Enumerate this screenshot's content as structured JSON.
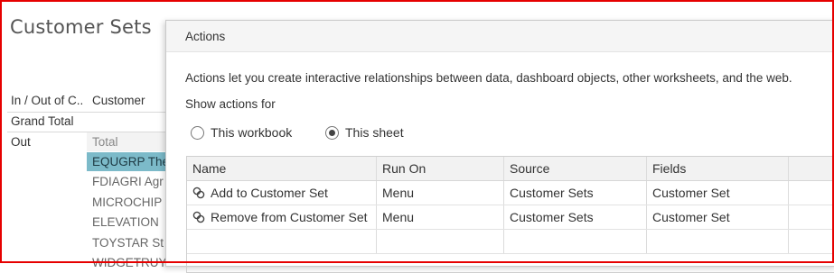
{
  "worksheet": {
    "title": "Customer Sets",
    "col_in_out": "In / Out of C..",
    "col_customer": "Customer",
    "grand_total": "Grand Total",
    "out_label": "Out",
    "customers": [
      {
        "label": "Total",
        "state": "total"
      },
      {
        "label": "EQUGRP The",
        "state": "selected"
      },
      {
        "label": "FDIAGRI Agr",
        "state": "normal"
      },
      {
        "label": "MICROCHIP",
        "state": "normal"
      },
      {
        "label": "ELEVATION",
        "state": "normal"
      },
      {
        "label": "TOYSTAR St",
        "state": "normal"
      },
      {
        "label": "WIDGETRUY",
        "state": "normal"
      }
    ]
  },
  "dialog": {
    "title": "Actions",
    "description": "Actions let you create interactive relationships between data, dashboard objects, other worksheets, and the web.",
    "show_actions_for": "Show actions for",
    "radio_options": [
      {
        "label": "This workbook",
        "checked": false
      },
      {
        "label": "This sheet",
        "checked": true
      }
    ],
    "table": {
      "headers": [
        "Name",
        "Run On",
        "Source",
        "Fields",
        ""
      ],
      "rows": [
        [
          "Add to Customer Set",
          "Menu",
          "Customer Sets",
          "Customer Set",
          ""
        ],
        [
          "Remove from Customer Set",
          "Menu",
          "Customer Sets",
          "Customer Set",
          ""
        ]
      ],
      "row_icon": "link-icon"
    }
  },
  "colors": {
    "frame": "#e60000",
    "selected_row": "#7cbac9"
  }
}
